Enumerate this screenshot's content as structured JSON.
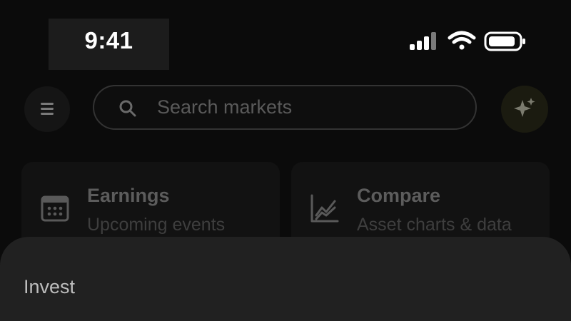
{
  "status_bar": {
    "time": "9:41",
    "icons": [
      "cellular-signal-icon",
      "wifi-icon",
      "battery-icon"
    ]
  },
  "header": {
    "menu_icon": "hamburger-menu-icon",
    "search": {
      "placeholder": "Search markets",
      "value": "",
      "icon": "search-icon"
    },
    "assistant_icon": "sparkle-icon"
  },
  "cards": [
    {
      "title": "Earnings",
      "subtitle": "Upcoming events",
      "icon": "calendar-icon"
    },
    {
      "title": "Compare",
      "subtitle": "Asset charts & data",
      "icon": "chart-icon"
    }
  ],
  "sheet": {
    "label": "Invest"
  },
  "colors": {
    "background": "#0b0b0b",
    "sheet": "#212121",
    "accent_dim": "#1b1b10"
  }
}
